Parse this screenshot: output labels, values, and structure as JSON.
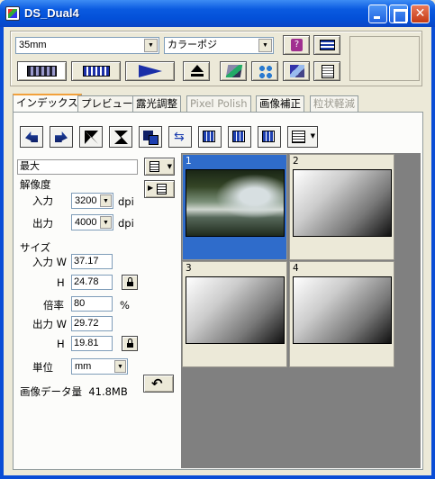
{
  "window": {
    "title": "DS_Dual4"
  },
  "toolbar": {
    "film_type": "35mm",
    "color_mode": "カラーポジ"
  },
  "tabs": [
    {
      "label": "インデックス"
    },
    {
      "label": "プレビュー"
    },
    {
      "label": "露光調整"
    },
    {
      "label": "Pixel Polish"
    },
    {
      "label": "画像補正"
    },
    {
      "label": "粒状軽減"
    }
  ],
  "settings": {
    "max_label": "最大",
    "resolution_label": "解像度",
    "input_label": "入力",
    "input_dpi": "3200",
    "output_label": "出力",
    "output_dpi": "4000",
    "dpi_unit": "dpi",
    "size_label": "サイズ",
    "input_w_label": "入力 W",
    "input_w": "37.17",
    "h_label": "H",
    "input_h": "24.78",
    "scale_label": "倍率",
    "scale": "80",
    "percent": "%",
    "output_w_label": "出力 W",
    "output_w": "29.72",
    "output_h": "19.81",
    "unit_label": "単位",
    "unit": "mm",
    "data_size_label": "画像データ量",
    "data_size": "41.8MB"
  },
  "thumbnails": [
    {
      "num": "1"
    },
    {
      "num": "2"
    },
    {
      "num": "3"
    },
    {
      "num": "4"
    }
  ]
}
